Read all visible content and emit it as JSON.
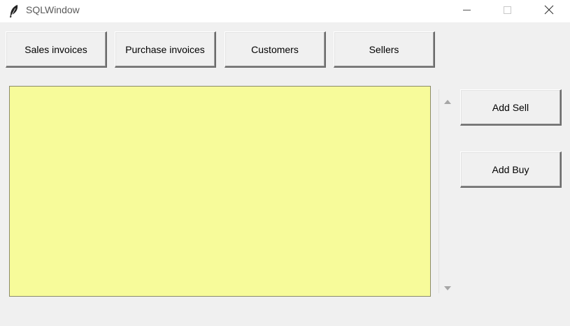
{
  "window": {
    "title": "SQLWindow"
  },
  "toolbar": {
    "sales_invoices": "Sales invoices",
    "purchase_invoices": "Purchase invoices",
    "customers": "Customers",
    "sellers": "Sellers"
  },
  "side_actions": {
    "add_sell": "Add Sell",
    "add_buy": "Add Buy"
  },
  "listbox": {
    "items": [],
    "background_color": "#f7fb9a"
  },
  "icons": {
    "app": "feather-icon",
    "minimize": "minimize-icon",
    "maximize": "maximize-icon",
    "close": "close-icon",
    "scroll_up": "triangle-up-icon",
    "scroll_down": "triangle-down-icon"
  }
}
